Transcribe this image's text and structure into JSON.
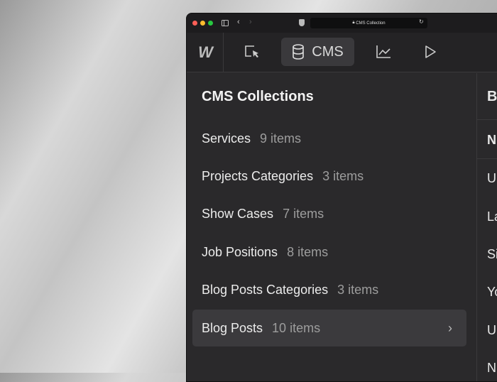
{
  "browser": {
    "url": "CMS Collection"
  },
  "toolbar": {
    "cms_label": "CMS"
  },
  "panel": {
    "title": "CMS Collections",
    "items": [
      {
        "name": "Services",
        "count": "9 items"
      },
      {
        "name": "Projects Categories",
        "count": "3 items"
      },
      {
        "name": "Show Cases",
        "count": "7 items"
      },
      {
        "name": "Job Positions",
        "count": "8 items"
      },
      {
        "name": "Blog Posts Categories",
        "count": "3 items"
      },
      {
        "name": "Blog Posts",
        "count": "10 items"
      }
    ]
  },
  "right": {
    "title": "B",
    "header": "N",
    "rows": [
      "U",
      "La",
      "Si",
      "Yo",
      "U",
      "N"
    ]
  },
  "colors": {
    "close": "#fe5f57",
    "min": "#febc2e",
    "max": "#28c840"
  }
}
